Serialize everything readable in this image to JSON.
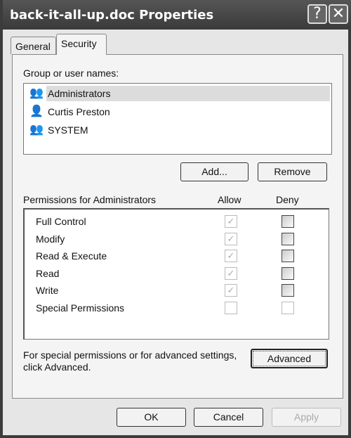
{
  "window": {
    "title": "back-it-all-up.doc Properties",
    "help_icon": "question-mark-icon",
    "close_icon": "close-x-icon"
  },
  "tabs": [
    {
      "label": "General",
      "active": false
    },
    {
      "label": "Security",
      "active": true
    }
  ],
  "group_label": "Group or user names:",
  "users": [
    {
      "name": "Administrators",
      "icon": "user-group-icon",
      "selected": true
    },
    {
      "name": "Curtis Preston",
      "icon": "user-icon",
      "selected": false
    },
    {
      "name": "SYSTEM",
      "icon": "user-group-icon",
      "selected": false
    }
  ],
  "buttons": {
    "add": "Add...",
    "remove": "Remove",
    "advanced": "Advanced",
    "ok": "OK",
    "cancel": "Cancel",
    "apply": "Apply"
  },
  "permissions": {
    "label": "Permissions for Administrators",
    "allow_header": "Allow",
    "deny_header": "Deny",
    "rows": [
      {
        "name": "Full Control",
        "allow": true,
        "deny": false
      },
      {
        "name": "Modify",
        "allow": true,
        "deny": false
      },
      {
        "name": "Read & Execute",
        "allow": true,
        "deny": false
      },
      {
        "name": "Read",
        "allow": true,
        "deny": false
      },
      {
        "name": "Write",
        "allow": true,
        "deny": false
      },
      {
        "name": "Special Permissions",
        "allow": false,
        "deny": false
      }
    ]
  },
  "advanced_note_line1": "For special permissions or for advanced settings,",
  "advanced_note_line2": "click Advanced."
}
